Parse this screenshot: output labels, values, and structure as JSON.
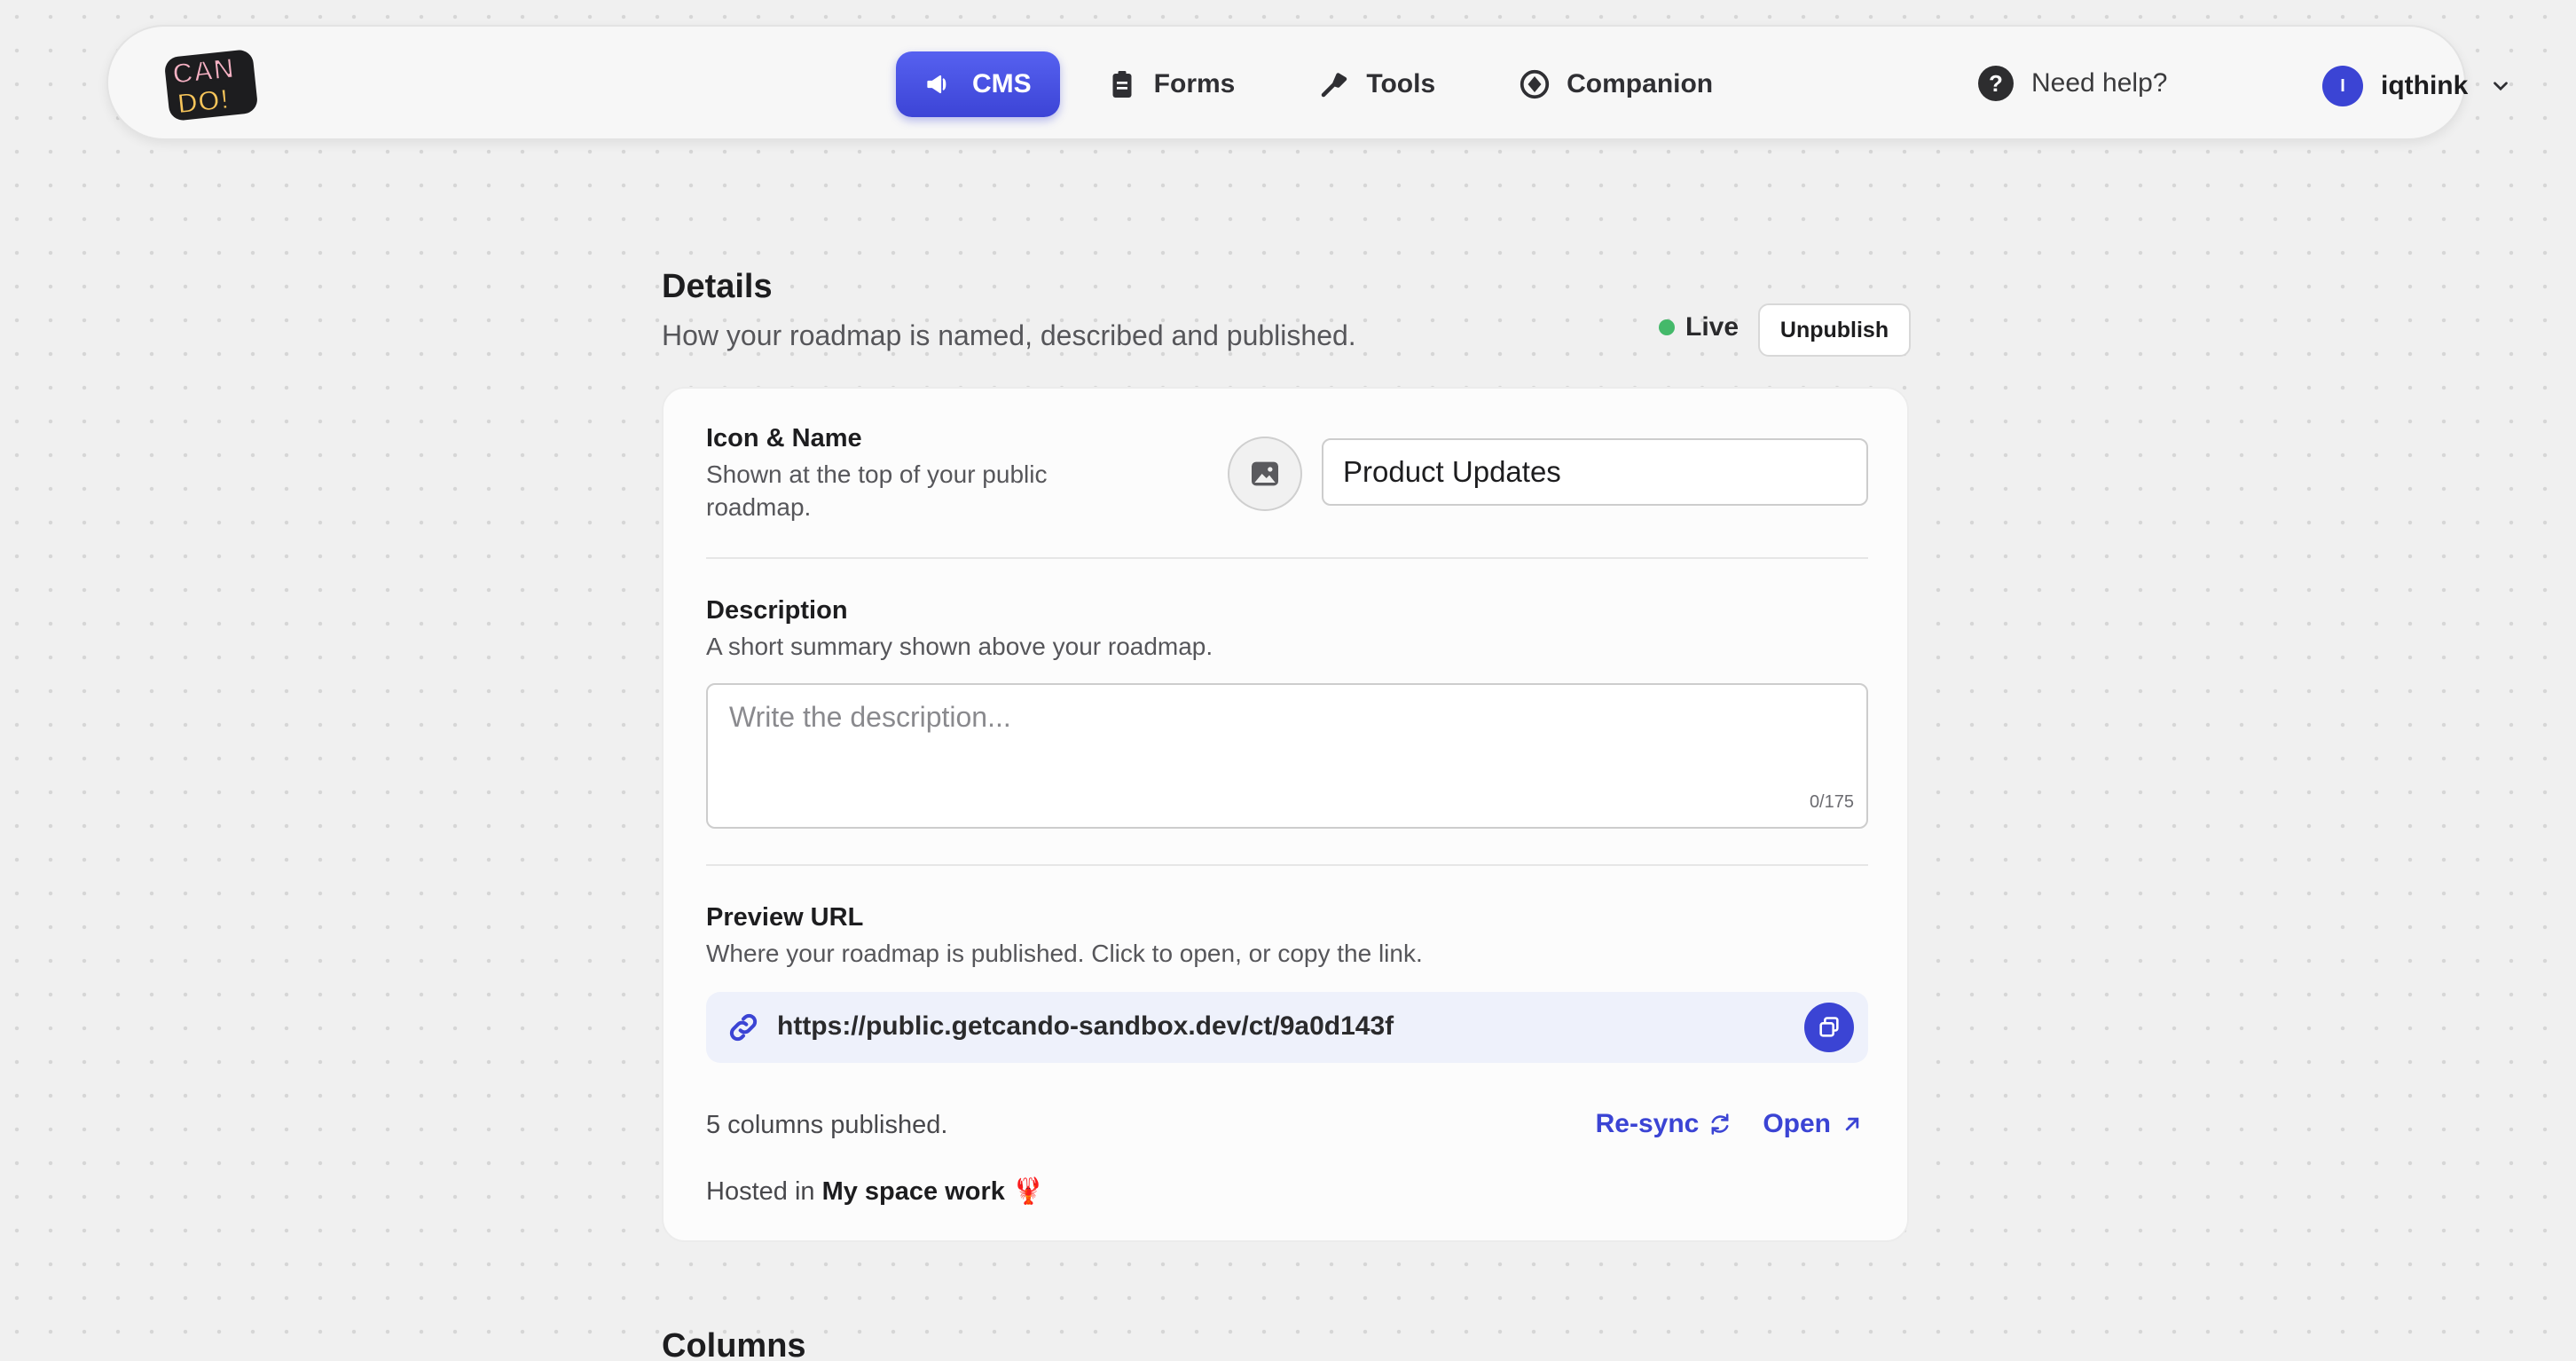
{
  "header": {
    "logo_text": "CAN DO!",
    "nav": [
      {
        "label": "CMS",
        "icon": "megaphone-icon",
        "active": true
      },
      {
        "label": "Forms",
        "icon": "clipboard-icon",
        "active": false
      },
      {
        "label": "Tools",
        "icon": "tools-icon",
        "active": false
      },
      {
        "label": "Companion",
        "icon": "companion-icon",
        "active": false
      }
    ],
    "help_label": "Need help?",
    "help_glyph": "?",
    "user": {
      "initial": "I",
      "name": "iqthink"
    }
  },
  "details": {
    "title": "Details",
    "subtitle": "How your roadmap is named, described and published.",
    "status_label": "Live",
    "unpublish_label": "Unpublish",
    "icon_name": {
      "label": "Icon & Name",
      "help": "Shown at the top of your public roadmap.",
      "value": "Product Updates"
    },
    "description": {
      "label": "Description",
      "help": "A short summary shown above your roadmap.",
      "placeholder": "Write the description...",
      "counter": "0/175"
    },
    "preview_url": {
      "label": "Preview URL",
      "help": "Where your roadmap is published. Click to open, or copy the link.",
      "url": "https://public.getcando-sandbox.dev/ct/9a0d143f"
    },
    "columns_published": "5 columns published.",
    "resync_label": "Re-sync",
    "open_label": "Open",
    "hosted_prefix": "Hosted in",
    "hosted_space": "My space work",
    "hosted_emoji": "🦞"
  },
  "next_section_title": "Columns",
  "colors": {
    "accent": "#3b44d4",
    "live": "#44b96a"
  }
}
